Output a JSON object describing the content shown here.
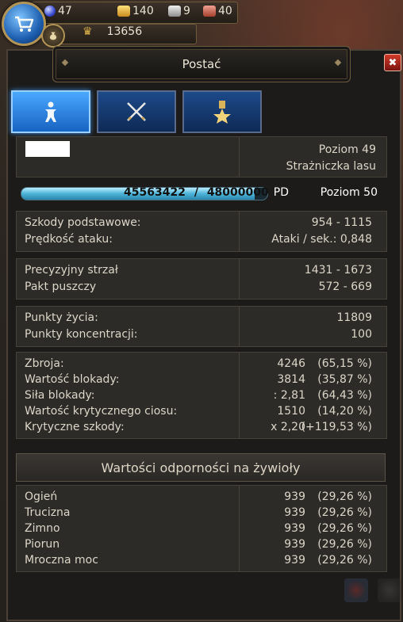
{
  "resources": {
    "gems": "47",
    "gold": "140",
    "silver": "9",
    "copper": "40",
    "honor": "13656"
  },
  "window": {
    "title": "Postać",
    "close": "✖"
  },
  "tabs": [
    {
      "name": "character",
      "icon": "person-icon",
      "active": true
    },
    {
      "name": "equipment",
      "icon": "crossed-swords-icon",
      "active": false
    },
    {
      "name": "achievements",
      "icon": "medal-star-icon",
      "active": false
    }
  ],
  "character": {
    "level": "Poziom 49",
    "title": "Strażniczka lasu"
  },
  "experience": {
    "current": "45563422",
    "separator": "/",
    "max": "48000000",
    "unit": "PD",
    "fraction": 0.949,
    "next_level": "Poziom 50"
  },
  "attack": [
    {
      "label": "Szkody podstawowe:",
      "value": "954 - 1115"
    },
    {
      "label": "Prędkość ataku:",
      "value": "Ataki / sek.: 0,848"
    }
  ],
  "skills": [
    {
      "label": "Precyzyjny strzał",
      "value": "1431 - 1673"
    },
    {
      "label": "Pakt puszczy",
      "value": "572 - 669"
    }
  ],
  "vitals": [
    {
      "label": "Punkty życia:",
      "value": "11809"
    },
    {
      "label": "Punkty koncentracji:",
      "value": "100"
    }
  ],
  "defense": [
    {
      "label": "Zbroja:",
      "value": "4246",
      "pct": "(65,15 %)"
    },
    {
      "label": "Wartość blokady:",
      "value": "3814",
      "pct": "(35,87 %)"
    },
    {
      "label": "Siła blokady:",
      "value": ": 2,81",
      "pct": "(64,43 %)"
    },
    {
      "label": "Wartość krytycznego ciosu:",
      "value": "1510",
      "pct": "(14,20 %)"
    },
    {
      "label": "Krytyczne szkody:",
      "value": "x 2,20",
      "pct": "(+119,53 %)"
    }
  ],
  "resistances": {
    "title": "Wartości odporności na żywioły",
    "rows": [
      {
        "label": "Ogień",
        "value": "939",
        "pct": "(29,26 %)"
      },
      {
        "label": "Trucizna",
        "value": "939",
        "pct": "(29,26 %)"
      },
      {
        "label": "Zimno",
        "value": "939",
        "pct": "(29,26 %)"
      },
      {
        "label": "Piorun",
        "value": "939",
        "pct": "(29,26 %)"
      },
      {
        "label": "Mroczna moc",
        "value": "939",
        "pct": "(29,26 %)"
      }
    ]
  },
  "colors": {
    "accent": "#4aa8ff",
    "xp": "#4db3d8",
    "close": "#d23a2a"
  }
}
